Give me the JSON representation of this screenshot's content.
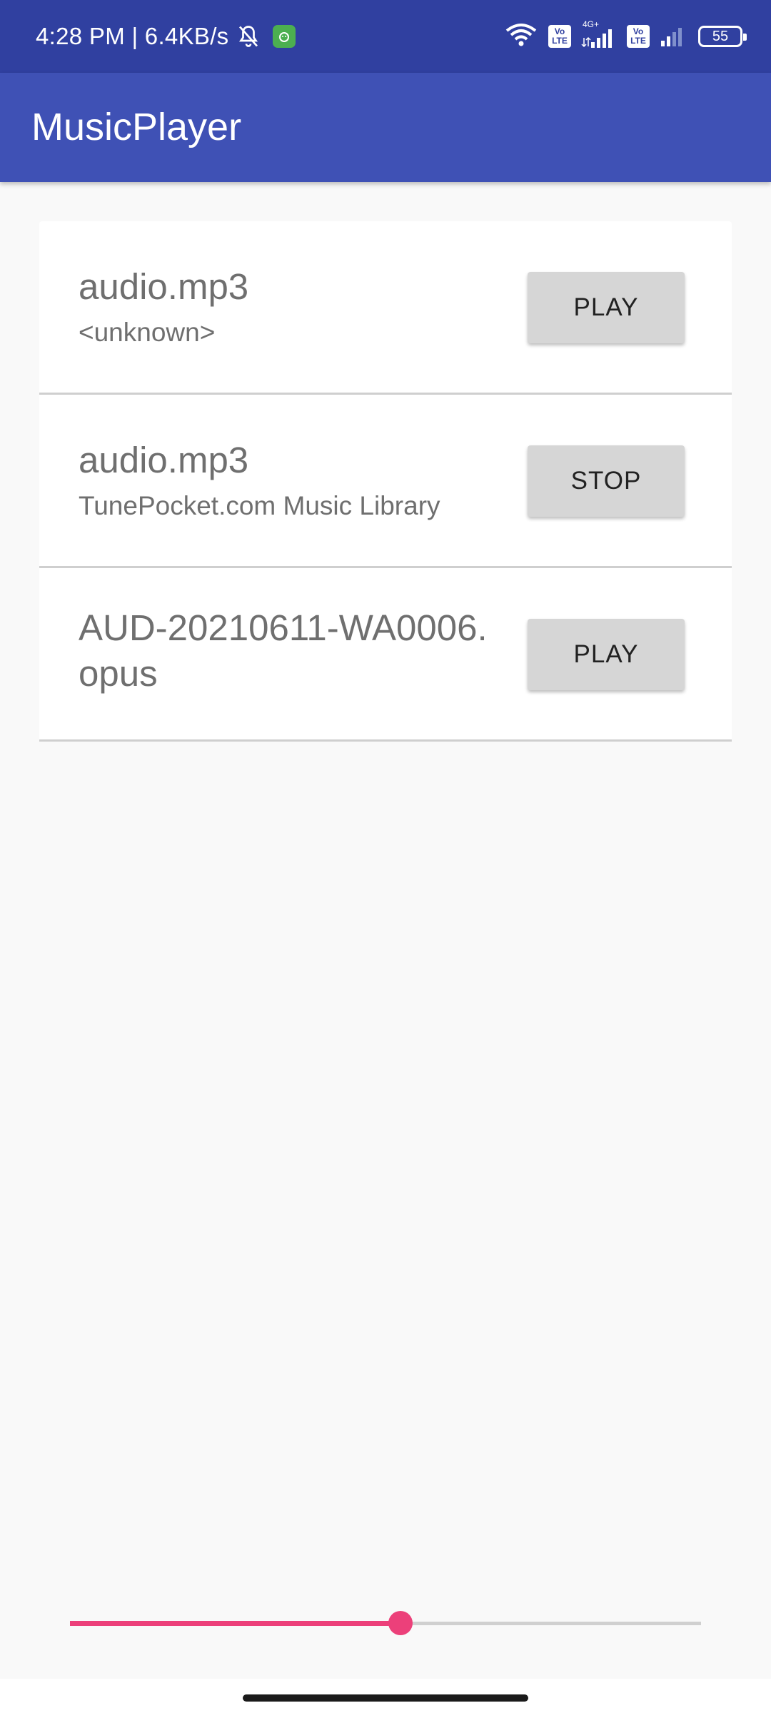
{
  "status_bar": {
    "time_speed": "4:28 PM | 6.4KB/s",
    "icons": [
      "bell-off-icon",
      "app-badge-icon",
      "wifi-icon",
      "volte-icon",
      "signal-4g-icon",
      "volte-icon",
      "signal-icon",
      "battery-icon"
    ],
    "volte_label_top": "Vo",
    "volte_label_bottom": "LTE",
    "network_type": "4G+",
    "battery_level": "55"
  },
  "app_bar": {
    "title": "MusicPlayer"
  },
  "tracks": [
    {
      "title": "audio.mp3",
      "subtitle": "<unknown>",
      "button_label": "PLAY"
    },
    {
      "title": "audio.mp3",
      "subtitle": "TunePocket.com Music Library",
      "button_label": "STOP"
    },
    {
      "title": "AUD-20210611-WA0006.\nopus",
      "subtitle": "",
      "button_label": "PLAY"
    }
  ],
  "seekbar": {
    "progress": 0.524
  },
  "colors": {
    "status_bar": "#3040a0",
    "app_bar": "#3f51b5",
    "accent": "#ec407a",
    "background": "#f9f9f9"
  }
}
